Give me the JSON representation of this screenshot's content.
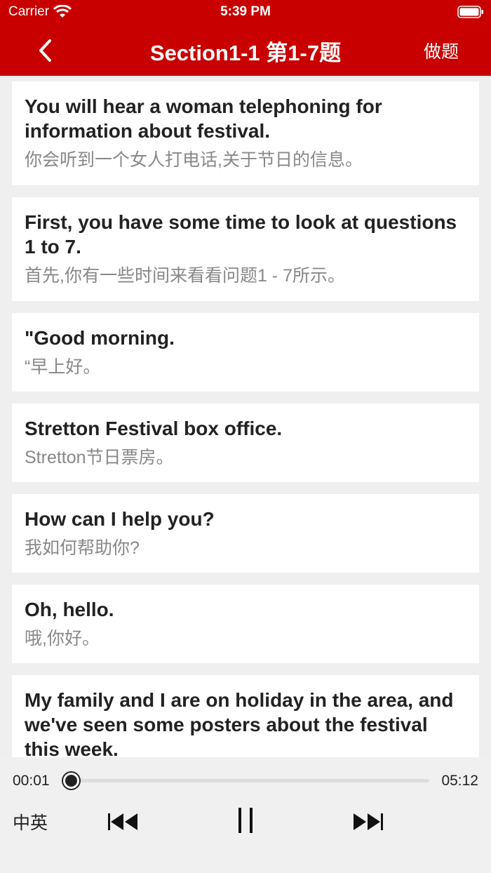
{
  "status_bar": {
    "carrier": "Carrier",
    "time": "5:39 PM"
  },
  "nav": {
    "title": "Section1-1 第1-7题",
    "right_button": "做题"
  },
  "transcript": [
    {
      "en": "You will hear a woman telephoning for information about festival.",
      "zh": "你会听到一个女人打电话,关于节日的信息。"
    },
    {
      "en": "First, you have some time to look at questions 1 to 7.",
      "zh": "首先,你有一些时间来看看问题1 - 7所示。"
    },
    {
      "en": "\"Good morning.",
      "zh": "“早上好。"
    },
    {
      "en": "Stretton Festival box office.",
      "zh": "Stretton节日票房。"
    },
    {
      "en": "How can I help you?",
      "zh": "我如何帮助你?"
    },
    {
      "en": "Oh, hello.",
      "zh": "哦,你好。"
    },
    {
      "en": "My family and I are on holiday in the area, and we've seen some posters about the festival this week.",
      "zh": ""
    }
  ],
  "player": {
    "current_time": "00:01",
    "total_time": "05:12",
    "progress": 0.003,
    "lang_toggle": "中英"
  },
  "colors": {
    "brand": "#c80000",
    "background": "#efefef"
  }
}
